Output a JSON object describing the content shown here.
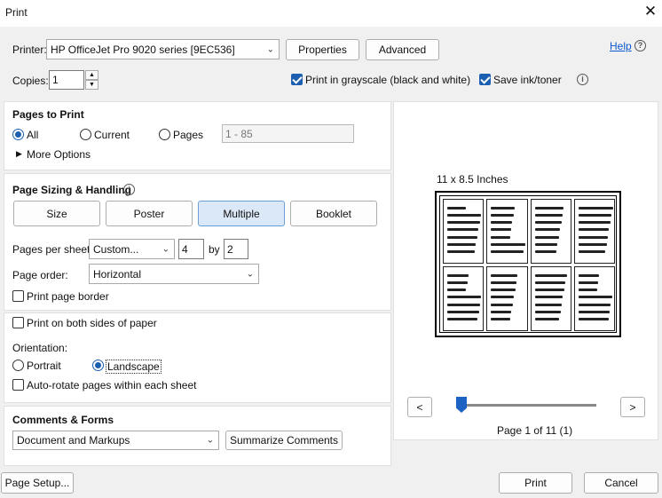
{
  "window": {
    "title": "Print",
    "close_glyph": "✕"
  },
  "printer": {
    "label": "Printer:",
    "selected": "HP OfficeJet Pro 9020 series [9EC536]",
    "properties_label": "Properties",
    "advanced_label": "Advanced",
    "help_label": "Help"
  },
  "copies": {
    "label": "Copies:",
    "value": "1"
  },
  "options": {
    "grayscale_label": "Print in grayscale (black and white)",
    "grayscale_checked": true,
    "save_ink_label": "Save ink/toner",
    "save_ink_checked": true
  },
  "pages_to_print": {
    "heading": "Pages to Print",
    "all_label": "All",
    "current_label": "Current",
    "pages_label": "Pages",
    "pages_placeholder": "1 - 85",
    "more_options_label": "More Options"
  },
  "sizing": {
    "heading": "Page Sizing & Handling",
    "tabs": [
      "Size",
      "Poster",
      "Multiple",
      "Booklet"
    ],
    "active_tab": "Multiple",
    "pages_per_sheet_label": "Pages per sheet:",
    "pages_per_sheet_value": "Custom...",
    "cols": "4",
    "by_label": "by",
    "rows": "2",
    "page_order_label": "Page order:",
    "page_order_value": "Horizontal",
    "print_border_label": "Print page border"
  },
  "duplex": {
    "both_sides_label": "Print on both sides of paper",
    "orientation_label": "Orientation:",
    "portrait_label": "Portrait",
    "landscape_label": "Landscape",
    "autorotate_label": "Auto-rotate pages within each sheet"
  },
  "comments": {
    "heading": "Comments & Forms",
    "value": "Document and Markups",
    "summarize_label": "Summarize Comments"
  },
  "preview": {
    "size_label": "11 x 8.5 Inches",
    "prev_label": "<",
    "next_label": ">",
    "page_label": "Page 1 of 11 (1)"
  },
  "footer": {
    "page_setup_label": "Page Setup...",
    "print_label": "Print",
    "cancel_label": "Cancel"
  },
  "colors": {
    "accent": "#1c5fb1",
    "link": "#0b57d0"
  }
}
